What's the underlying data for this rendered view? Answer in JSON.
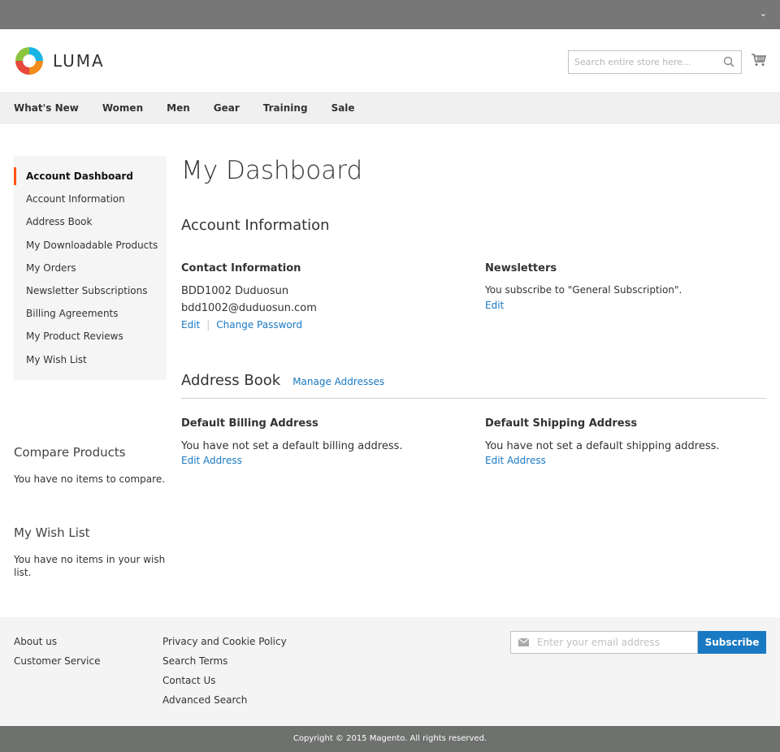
{
  "brand": {
    "name": "LUMA"
  },
  "search": {
    "placeholder": "Search entire store here..."
  },
  "nav": [
    "What's New",
    "Women",
    "Men",
    "Gear",
    "Training",
    "Sale"
  ],
  "sidebar": {
    "items": [
      {
        "label": "Account Dashboard",
        "active": true
      },
      {
        "label": "Account Information"
      },
      {
        "label": "Address Book"
      },
      {
        "label": "My Downloadable Products"
      },
      {
        "label": "My Orders"
      },
      {
        "label": "Newsletter Subscriptions"
      },
      {
        "label": "Billing Agreements"
      },
      {
        "label": "My Product Reviews"
      },
      {
        "label": "My Wish List"
      }
    ],
    "compare": {
      "title": "Compare Products",
      "text": "You have no items to compare."
    },
    "wishlist": {
      "title": "My Wish List",
      "text": "You have no items in your wish list."
    }
  },
  "main": {
    "title": "My Dashboard",
    "account_info": {
      "title": "Account Information",
      "contact": {
        "title": "Contact Information",
        "name": "BDD1002 Duduosun",
        "email": "bdd1002@duduosun.com",
        "edit": "Edit",
        "change_password": "Change Password"
      },
      "newsletters": {
        "title": "Newsletters",
        "text": "You subscribe to \"General Subscription\".",
        "edit": "Edit"
      }
    },
    "address_book": {
      "title": "Address Book",
      "manage": "Manage Addresses",
      "billing": {
        "title": "Default Billing Address",
        "text": "You have not set a default billing address.",
        "edit": "Edit Address"
      },
      "shipping": {
        "title": "Default Shipping Address",
        "text": "You have not set a default shipping address.",
        "edit": "Edit Address"
      }
    }
  },
  "footer": {
    "col1": [
      "About us",
      "Customer Service"
    ],
    "col2": [
      "Privacy and Cookie Policy",
      "Search Terms",
      "Contact Us",
      "Advanced Search"
    ],
    "newsletter": {
      "placeholder": "Enter your email address",
      "button": "Subscribe"
    },
    "copyright": "Copyright © 2015 Magento. All rights reserved."
  },
  "colors": {
    "accent": "#1979c3",
    "active_marker": "#ff5501",
    "topbar": "#777777"
  }
}
